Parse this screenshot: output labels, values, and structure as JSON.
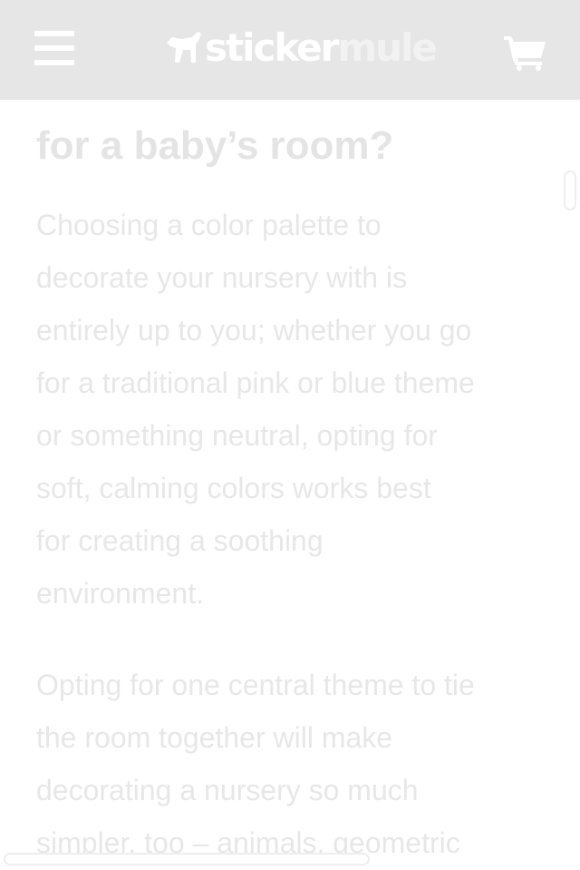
{
  "header": {
    "menu_icon": "hamburger-menu-icon",
    "logo": {
      "icon": "horse-logo-icon",
      "text_part1": "sticker",
      "text_part2": "mule"
    },
    "cart_icon": "shopping-cart-icon"
  },
  "article": {
    "heading": "for a baby’s room?",
    "paragraphs": [
      {
        "lines": [
          "Choosing a color palette to",
          "decorate your nursery with is",
          "entirely up to you; whether you go",
          "for a traditional pink or blue theme",
          "or something neutral, opting for",
          "soft, calming colors works best",
          "for creating a soothing",
          "environment."
        ]
      },
      {
        "lines": [
          "Opting for one central theme to tie",
          "the room together will make",
          "decorating a nursery so much",
          "simpler, too – animals, geometric"
        ]
      }
    ]
  },
  "colors": {
    "header_bg": "#e6e6e6",
    "header_fg": "#ffffff",
    "text": "#e7e7e7"
  }
}
